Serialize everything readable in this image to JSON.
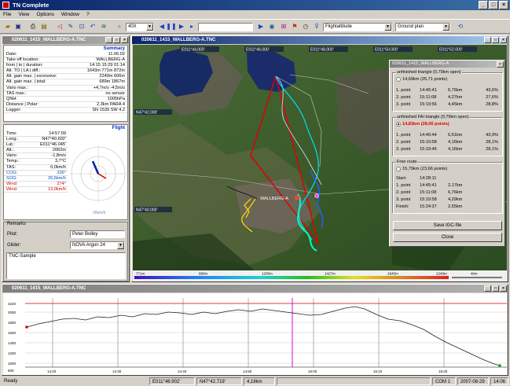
{
  "app": {
    "title": "TN Complete"
  },
  "menu": [
    "File",
    "View",
    "Options",
    "Window",
    "?"
  ],
  "toolbar": {
    "zoom": "40X",
    "mode": "Flightaltitude",
    "view": "Ground plan"
  },
  "summary_window": {
    "title": "020611_1415_WALLBERG-A.TNC"
  },
  "summary": {
    "heading": "Summary",
    "rows": [
      {
        "label": "Date:",
        "value": "11.06.02"
      },
      {
        "label": "Take off location:",
        "value": "WALLBERG-A"
      },
      {
        "label": "from | to | duration:",
        "value": "14:15  15:29  01:14"
      },
      {
        "label": "Alt. TO | LA | diff.:",
        "value": "1643m  771m  872m"
      },
      {
        "label": "Alt. gain max. | excessive:",
        "value": "2249m  606m"
      },
      {
        "label": "Alt. gain max. | total:",
        "value": "689m  1867m"
      },
      {
        "label": "Vario max.:",
        "value": "+4,7m/s  -4,5m/s"
      },
      {
        "label": "TAS max.:",
        "value": "no sensor"
      },
      {
        "label": "QNH:",
        "value": "1005hPa"
      },
      {
        "label": "Distance | Polar:",
        "value": "2,3km  PARA 4"
      },
      {
        "label": "Logger:",
        "value": "SN 1539  SW 4.2"
      }
    ]
  },
  "flight": {
    "heading": "Flight",
    "rows": [
      {
        "label": "Time:",
        "value": "14:57:09"
      },
      {
        "label": "Long.:",
        "value": "N47°40.602'"
      },
      {
        "label": "Lat.:",
        "value": "E011°46.045'"
      },
      {
        "label": "Alt.:",
        "value": "2062m"
      },
      {
        "label": "Vario:",
        "value": "-1,8m/s"
      },
      {
        "label": "Temp.:",
        "value": "3,7°C"
      },
      {
        "label": "TAS:",
        "value": "0,0km/h"
      },
      {
        "label": "COG:",
        "value": "336°"
      },
      {
        "label": "SOG:",
        "value": "26,5km/h"
      },
      {
        "label": "Wind:",
        "value": "274°"
      },
      {
        "label": "Wind:",
        "value": "13,0km/h"
      }
    ],
    "compass_label": "30km/h"
  },
  "remarks": {
    "heading": "Remarks",
    "pilot_label": "Pilot:",
    "pilot": "Peter Bolley",
    "glider_label": "Glider:",
    "glider": "NOVA Argon 24",
    "notes": "TNC-Sample"
  },
  "map_window": {
    "title": "020611_1415_WALLBERG-A.TNC",
    "top_coords": [
      "E011°44.000'",
      "E011°46.000'",
      "E011°48.000'",
      "E011°50.000'",
      "E011°52.000'"
    ],
    "left_coords": [
      "N47°42.000'",
      "N47°40.000'"
    ],
    "legend": [
      "771m",
      "990m",
      "1205m",
      "1427m",
      "1645m",
      "2249m"
    ],
    "scale": "4km",
    "label": "WALLBERG-A"
  },
  "dialog": {
    "title": "020611_1415_WALLBERG-A",
    "g1": {
      "title": "unfinished triangle (0,79km open)",
      "option": "14,69km (25,71 points)",
      "rows": [
        [
          "1. point",
          "14:45:41",
          "6,76km",
          "43,6%"
        ],
        [
          "2. point",
          "15:11:08",
          "4,27km",
          "27,6%"
        ],
        [
          "3. point",
          "15:19:56",
          "4,45km",
          "28,8%"
        ]
      ]
    },
    "g2": {
      "title": "unfinished FAI triangle (0,79km open)",
      "option": "14,83km (28,06 points)",
      "rows": [
        [
          "1. point",
          "14:46:44",
          "6,51km",
          "43,9%"
        ],
        [
          "2. point",
          "15:10:58",
          "4,16km",
          "28,1%"
        ],
        [
          "3. point",
          "15:19:46",
          "4,16km",
          "28,1%"
        ]
      ]
    },
    "g3": {
      "title": "Free route",
      "option": "15,79km (23,66 points)",
      "rows": [
        [
          "Start:",
          "14:28:11",
          ""
        ],
        [
          "1. point",
          "14:45:41",
          "2,17km"
        ],
        [
          "2. point",
          "15:11:08",
          "6,76km"
        ],
        [
          "3. point",
          "15:19:58",
          "4,29km"
        ],
        [
          "Finish:",
          "15:24:37",
          "2,55km"
        ]
      ]
    },
    "save": "Save IGC-file",
    "close": "Close"
  },
  "profile_window": {
    "title": "020611_1415_WALLBERG-A.TNC"
  },
  "profile": {
    "y_ticks": [
      "2240",
      "2000",
      "1800",
      "1600",
      "1400",
      "1200",
      "1000",
      "800"
    ],
    "x_ticks": [
      "14:20",
      "14:30",
      "14:40",
      "14:50",
      "15:00",
      "15:10",
      "15:20"
    ]
  },
  "status": {
    "ready": "Ready",
    "lon": "E011°46.902'",
    "lat": "N47°42.719'",
    "dist": "4,18km",
    "com": "COM 1",
    "date": "2007-08-29",
    "time": "14:06"
  },
  "colors": {
    "title_active": "#0a246a",
    "fai": "#e00000",
    "track_cyan": "#00e0ff",
    "track_yellow": "#ffe000"
  }
}
